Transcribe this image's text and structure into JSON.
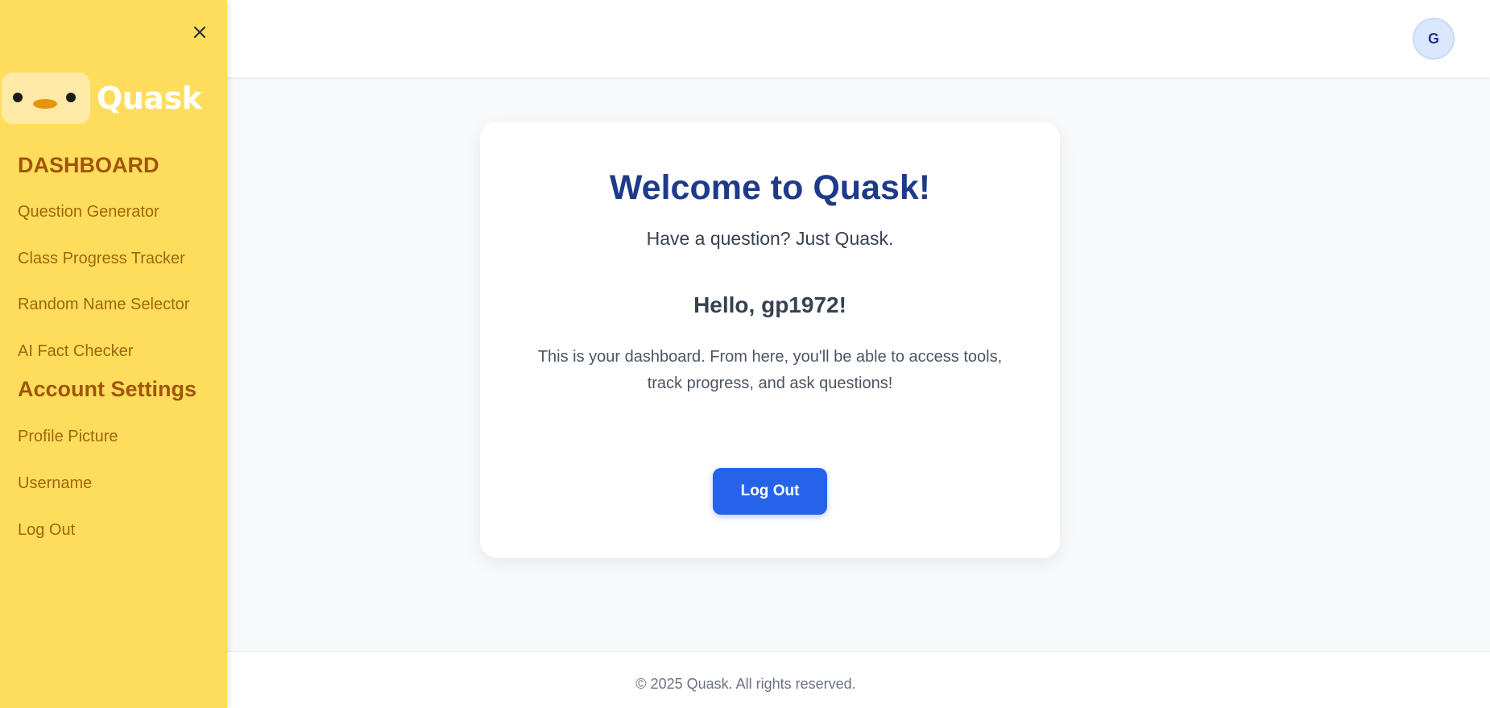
{
  "app": {
    "name": "Quask"
  },
  "sidebar": {
    "headings": {
      "dashboard": "DASHBOARD",
      "account": "Account Settings"
    },
    "dashboard_items": [
      {
        "label": "Question Generator"
      },
      {
        "label": "Class Progress Tracker"
      },
      {
        "label": "Random Name Selector"
      },
      {
        "label": "AI Fact Checker"
      }
    ],
    "account_items": [
      {
        "label": "Profile Picture"
      },
      {
        "label": "Username"
      },
      {
        "label": "Log Out"
      }
    ],
    "close_icon": "close-icon"
  },
  "header": {
    "avatar_initial": "G"
  },
  "main": {
    "title": "Welcome to Quask!",
    "tagline": "Have a question? Just Quask.",
    "greeting": "Hello, gp1972!",
    "description": "This is your dashboard. From here, you'll be able to access tools, track progress, and ask questions!",
    "logout_label": "Log Out"
  },
  "footer": {
    "text": "© 2025 Quask. All rights reserved."
  },
  "colors": {
    "sidebar_bg": "#ffdd5c",
    "heading": "#a0560a",
    "nav_text": "#a0650c",
    "title": "#1e3a8a",
    "primary_button": "#2563eb"
  }
}
